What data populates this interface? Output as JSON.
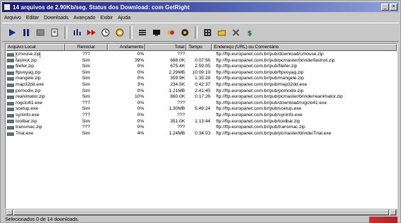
{
  "window": {
    "title": "14 arquivos de 2.90Kb/seg. Status dos Download: com GetRight",
    "min_label": "_",
    "close_label": "×"
  },
  "menu": [
    "Arquivo",
    "Editar",
    "Downloads",
    "Avançado",
    "Exibir",
    "Ajuda"
  ],
  "toolbar": {
    "icons": [
      "play-icon",
      "pause-icon",
      "stop-icon",
      "page-icon",
      "options-icon",
      "fast-forward-icon",
      "clock-icon",
      "schedule-icon",
      "list-icon",
      "monitor-icon",
      "transfer-icon",
      "settings-icon",
      "grid-icon",
      "folder-icon",
      "tools-icon",
      "dollar-icon"
    ]
  },
  "table": {
    "columns": [
      "Arquivo Local",
      "Reiniciar",
      "Andamento",
      "Total",
      "Tempo",
      "Endereço (URL) ou Comentário"
    ],
    "rows": [
      {
        "file": "cmouse.zip",
        "resume": "???",
        "progress": "0%",
        "total": "???",
        "time": "",
        "url": "ftp://ftp.europanet.com.br/pub/download/cmouse.zip"
      },
      {
        "file": "fastnot.zip",
        "resume": "Sim",
        "progress": "39%",
        "total": "688.0K",
        "time": "0:07:56",
        "url": "ftp://ftp.europanet.com.br/pub/pcmaster/brinde/fastnot.zip"
      },
      {
        "file": "filefer.zip",
        "resume": "Sim",
        "progress": "0%",
        "total": "675.4K",
        "time": "2:59:05",
        "url": "ftp://ftp.europanet.com.br/pub/filefer.zip"
      },
      {
        "file": "ftpvoyag.zip",
        "resume": "Sim",
        "progress": "0%",
        "total": "2.29MB",
        "time": "10:09:19",
        "url": "ftp://ftp.europanet.com.br/pub/ftpvoyag.zip"
      },
      {
        "file": "mangele.zip",
        "resume": "Sim",
        "progress": "0%",
        "total": "359.9K",
        "time": "1:35:28",
        "url": "ftp://ftp.europanet.com.br/pub/mangele.zip"
      },
      {
        "file": "map32dd.exe",
        "resume": "Sim",
        "progress": "3%",
        "total": "234.5K",
        "time": "0:42:37",
        "url": "ftp://ftp.europanet.com.br/pub/map32dd.exe"
      },
      {
        "file": "pomodix.zip",
        "resume": "Sim",
        "progress": "0%",
        "total": "1.21MB",
        "time": "2:41:45",
        "url": "ftp://ftp.europanet.com.br/pub/pomodix.zip"
      },
      {
        "file": "reanimator.zip",
        "resume": "Sim",
        "progress": "10%",
        "total": "860.0K",
        "time": "0:17:26",
        "url": "ftp://ftp.europanet.com.br/pub/pcmaster/brinde/reanimator.zip"
      },
      {
        "file": "rogclo41.exe",
        "resume": "???",
        "progress": "0%",
        "total": "???",
        "time": "",
        "url": "ftp://ftp.europanet.com.br/pub/download/rogclo41.exe"
      },
      {
        "file": "scetup.exe",
        "resume": "Sim",
        "progress": "0%",
        "total": "1.30MB",
        "time": "5:49:24",
        "url": "ftp://ftp.europanet.com.br/pub/scetup.exe"
      },
      {
        "file": "syninfo.exe",
        "resume": "???",
        "progress": "0%",
        "total": "???",
        "time": "",
        "url": "ftp://ftp.europanet.com.br/pub/syninfo.exe"
      },
      {
        "file": "toolbar.zip",
        "resume": "Sim",
        "progress": "0%",
        "total": "351.0K",
        "time": "1:13:44",
        "url": "ftp://ftp.europanet.com.br/pub/toolbar.zip"
      },
      {
        "file": "transmac.zip",
        "resume": "???",
        "progress": "0%",
        "total": "???",
        "time": "",
        "url": "ftp://ftp.europanet.com.br/pub/transmac.zip"
      },
      {
        "file": "Trial.exe",
        "resume": "Sim",
        "progress": "4%",
        "total": "1.24MB",
        "time": "0:34:03",
        "url": "ftp://ftp.europanet.com.br/pub/pcmaster/brinde/Trial.exe"
      }
    ]
  },
  "status": {
    "text": "Selecionados 0 de 14 downloads."
  }
}
